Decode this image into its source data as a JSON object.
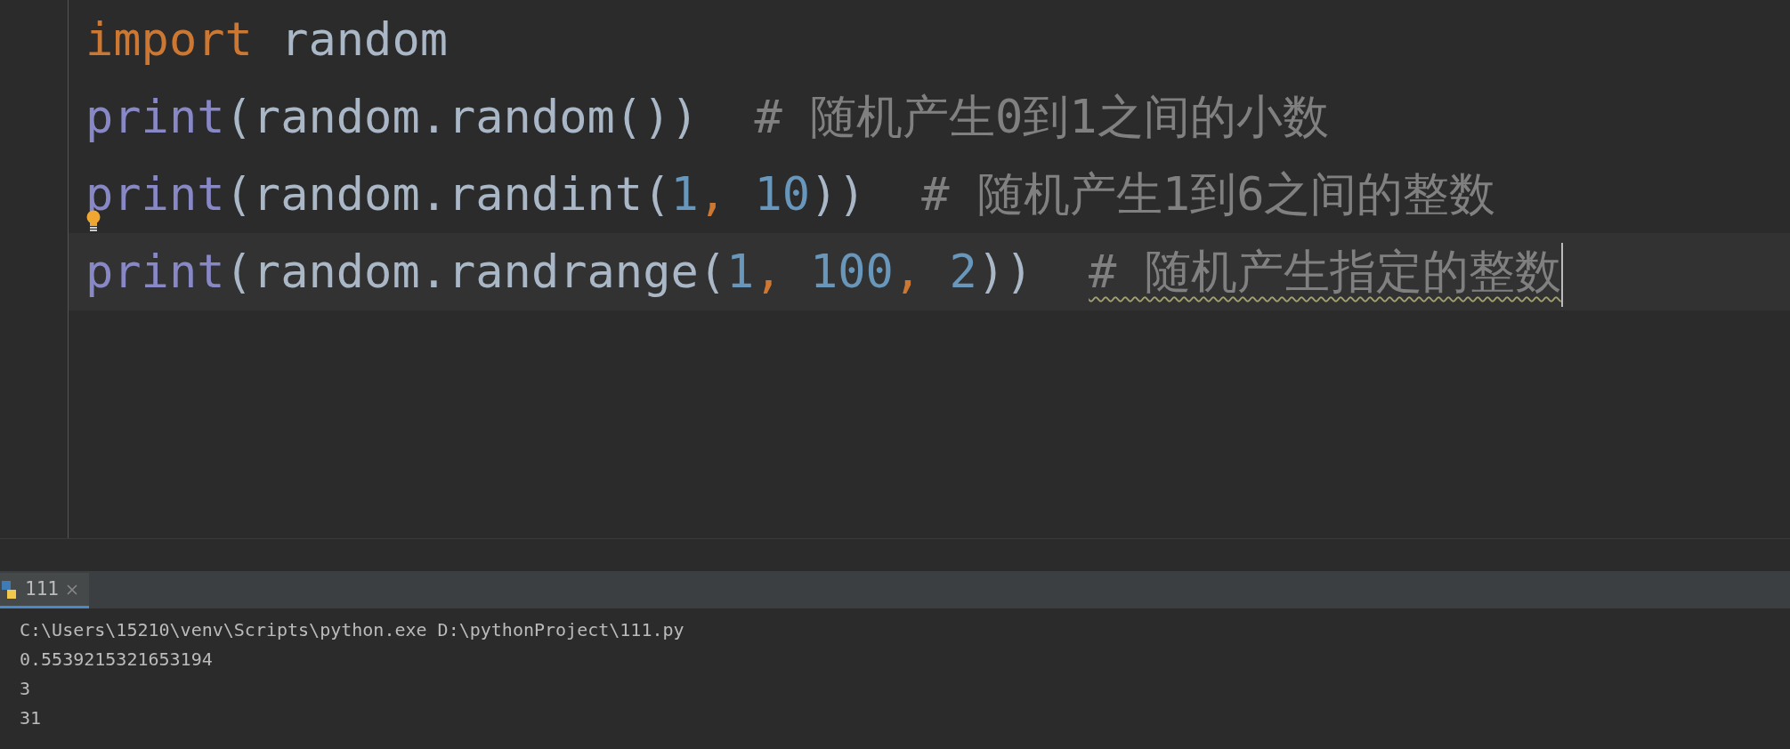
{
  "editor": {
    "lines": [
      {
        "current": false,
        "bulb": false,
        "tokens": [
          {
            "text": "import",
            "kind": "keyword"
          },
          {
            "text": " random",
            "kind": "ident"
          }
        ]
      },
      {
        "current": false,
        "bulb": false,
        "tokens": [
          {
            "text": "print",
            "kind": "builtin"
          },
          {
            "text": "(random.random())",
            "kind": "ident"
          },
          {
            "text": "  # 随机产生0到1之间的小数",
            "kind": "comment",
            "warning": false
          }
        ]
      },
      {
        "current": false,
        "bulb": true,
        "tokens": [
          {
            "text": "print",
            "kind": "builtin"
          },
          {
            "text": "(random.randint(",
            "kind": "ident"
          },
          {
            "text": "1",
            "kind": "number"
          },
          {
            "text": ",",
            "kind": "comma"
          },
          {
            "text": " 10",
            "kind": "number"
          },
          {
            "text": "))",
            "kind": "ident"
          },
          {
            "text": "  # 随机产生1到6之间的整数",
            "kind": "comment",
            "warning": false
          }
        ]
      },
      {
        "current": true,
        "bulb": false,
        "tokens": [
          {
            "text": "print",
            "kind": "builtin"
          },
          {
            "text": "(random.randrange(",
            "kind": "ident"
          },
          {
            "text": "1",
            "kind": "number"
          },
          {
            "text": ",",
            "kind": "comma"
          },
          {
            "text": " 100",
            "kind": "number"
          },
          {
            "text": ",",
            "kind": "comma"
          },
          {
            "text": " 2",
            "kind": "number"
          },
          {
            "text": "))  ",
            "kind": "ident"
          },
          {
            "text": "# 随机产生指定的整数",
            "kind": "comment",
            "warning": true
          }
        ]
      }
    ]
  },
  "run_tabs": [
    {
      "label": "111",
      "selected": true
    }
  ],
  "console": {
    "lines": [
      "C:\\Users\\15210\\venv\\Scripts\\python.exe D:\\pythonProject\\111.py",
      "0.5539215321653194",
      "3",
      "31"
    ]
  }
}
